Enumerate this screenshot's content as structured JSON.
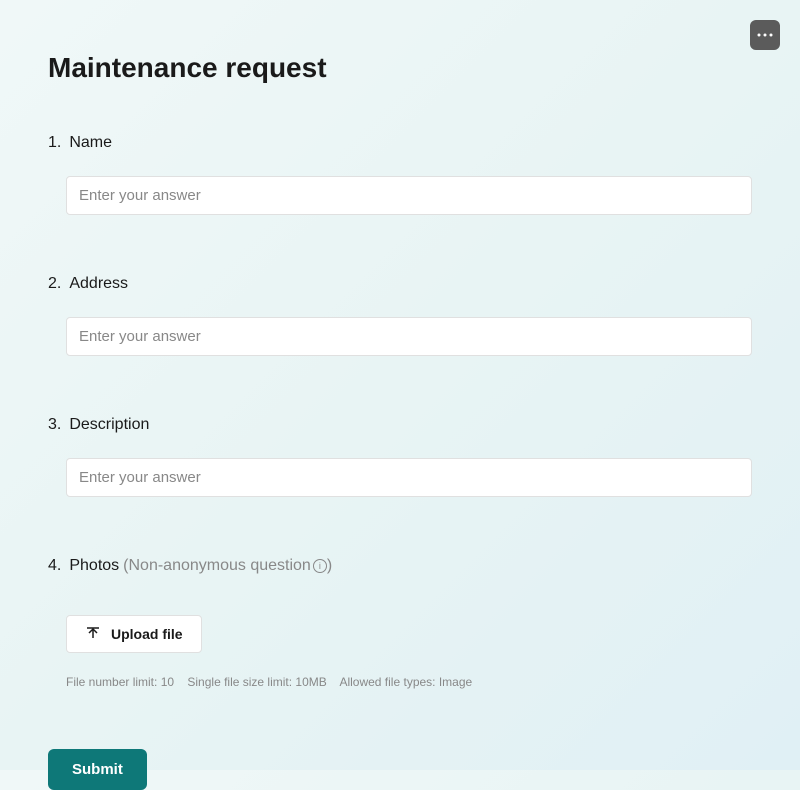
{
  "form": {
    "title": "Maintenance request",
    "questions": [
      {
        "number": "1.",
        "label": "Name",
        "placeholder": "Enter your answer"
      },
      {
        "number": "2.",
        "label": "Address",
        "placeholder": "Enter your answer"
      },
      {
        "number": "3.",
        "label": "Description",
        "placeholder": "Enter your answer"
      },
      {
        "number": "4.",
        "label": "Photos",
        "hint": "(Non-anonymous question",
        "upload_label": "Upload file",
        "file_limits": {
          "number": "File number limit: 10",
          "size": "Single file size limit: 10MB",
          "types": "Allowed file types: Image"
        }
      }
    ],
    "submit_label": "Submit"
  },
  "icons": {
    "info_glyph": "i"
  }
}
